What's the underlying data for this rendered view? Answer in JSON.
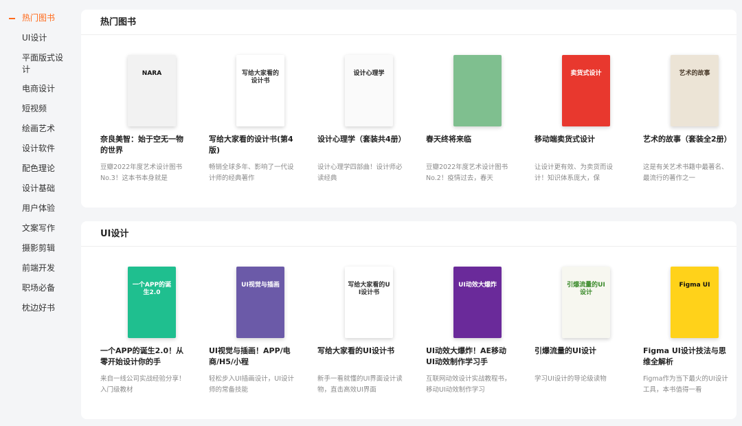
{
  "sidebar": {
    "items": [
      {
        "label": "热门图书",
        "active": true
      },
      {
        "label": "UI设计"
      },
      {
        "label": "平面版式设计"
      },
      {
        "label": "电商设计"
      },
      {
        "label": "短视频"
      },
      {
        "label": "绘画艺术"
      },
      {
        "label": "设计软件"
      },
      {
        "label": "配色理论"
      },
      {
        "label": "设计基础"
      },
      {
        "label": "用户体验"
      },
      {
        "label": "文案写作"
      },
      {
        "label": "摄影剪辑"
      },
      {
        "label": "前端开发"
      },
      {
        "label": "职场必备"
      },
      {
        "label": "枕边好书"
      }
    ]
  },
  "sections": [
    {
      "title": "热门图书",
      "books": [
        {
          "title": "奈良美智：始于空无一物的世界",
          "desc": "豆瓣2022年度艺术设计图书No.3！这本书本身就是",
          "cover_text": "NARA",
          "cover_bg": "#f2f2f2",
          "cover_fg": "#111111"
        },
        {
          "title": "写给大家看的设计书(第4版)",
          "desc": "畅销全球多年、影响了一代设计师的经典著作",
          "cover_text": "写给大家看的设计书",
          "cover_bg": "#ffffff",
          "cover_fg": "#333333"
        },
        {
          "title": "设计心理学（套装共4册）",
          "desc": "设计心理学四部曲！设计师必读经典",
          "cover_text": "设计心理学",
          "cover_bg": "#fafafa",
          "cover_fg": "#222222"
        },
        {
          "title": "春天终将来临",
          "desc": "豆瓣2022年度艺术设计图书No.2！疫情过去，春天",
          "cover_text": "",
          "cover_bg": "#7fbf8f",
          "cover_fg": "#ffffff"
        },
        {
          "title": "移动端卖货式设计",
          "desc": "让设计更有效、为卖货而设计！知识体系庞大，保",
          "cover_text": "卖货式设计",
          "cover_bg": "#e8382e",
          "cover_fg": "#ffffff"
        },
        {
          "title": "艺术的故事（套装全2册）",
          "desc": "这是有关艺术书籍中最著名、最流行的著作之一",
          "cover_text": "艺术的故事",
          "cover_bg": "#ece4d6",
          "cover_fg": "#4a3a2a"
        }
      ]
    },
    {
      "title": "UI设计",
      "books": [
        {
          "title": "一个APP的诞生2.0！从零开始设计你的手",
          "desc": "来自一线公司实战经验分享！入门级教材",
          "cover_text": "一个APP的诞生2.0",
          "cover_bg": "#1fbf8f",
          "cover_fg": "#ffffff"
        },
        {
          "title": "UI视觉与插画！APP/电商/H5/小程",
          "desc": "轻松步入UI插画设计，UI设计师的常备技能",
          "cover_text": "UI视觉与插画",
          "cover_bg": "#6b5aa8",
          "cover_fg": "#ffffff"
        },
        {
          "title": "写给大家看的UI设计书",
          "desc": "新手一看就懂的UI界面设计读物，直击高效UI界面",
          "cover_text": "写给大家看的UI设计书",
          "cover_bg": "#ffffff",
          "cover_fg": "#333333"
        },
        {
          "title": "UI动效大爆炸！AE移动UI动效制作学习手",
          "desc": "互联网动效设计实战教程书，移动UI动效制作学习",
          "cover_text": "UI动效大爆炸",
          "cover_bg": "#6a2a9a",
          "cover_fg": "#ffffff"
        },
        {
          "title": "引爆流量的UI设计",
          "desc": "学习UI设计的导论级读物",
          "cover_text": "引爆流量的UI设计",
          "cover_bg": "#f7f7f0",
          "cover_fg": "#3a8a2a"
        },
        {
          "title": "Figma UI设计技法与思维全解析",
          "desc": "Figma作为当下最火的UI设计工具，本书值得一看",
          "cover_text": "Figma UI",
          "cover_bg": "#ffd21a",
          "cover_fg": "#111111"
        }
      ]
    }
  ]
}
